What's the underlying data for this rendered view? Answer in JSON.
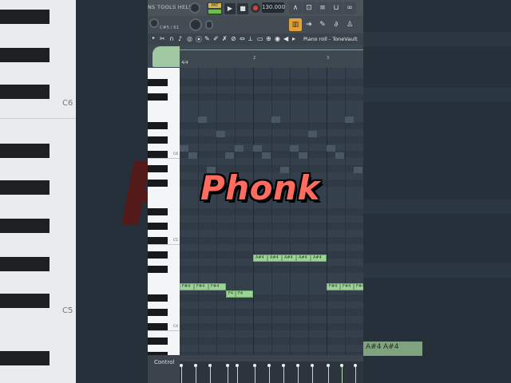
{
  "menu": {
    "text": "NS TOOLS HELP"
  },
  "pattern": {
    "label": "PAT"
  },
  "transport": {
    "tempo": "130.000"
  },
  "note_readout": "C#5 / 61",
  "piano_roll": {
    "title": "Piano roll - ToneVault"
  },
  "ruler": {
    "marks": [
      "2",
      "3"
    ],
    "signature": "4/4"
  },
  "key_labels": {
    "c6": "C6",
    "c5": "C5",
    "c4": "C4"
  },
  "bg_labels": {
    "c6": "C6",
    "c5": "C5"
  },
  "notes": {
    "as4_a": "A#4",
    "as4_b": "A#4",
    "as4_c": "A#4",
    "as4_d": "A#4",
    "as4_e": "A#4",
    "fs4_a": "F#4",
    "fs4_b": "F#4",
    "fs4_c": "F#4",
    "fs4_d": "F#4",
    "fs4_e": "F#4",
    "fs4_f": "F#4",
    "f4": "F4",
    "f4_b": "F4"
  },
  "bg_notes": {
    "a": "A#4",
    "b": "A#4"
  },
  "control": {
    "label": "Control"
  },
  "overlay_title": "Phonk"
}
